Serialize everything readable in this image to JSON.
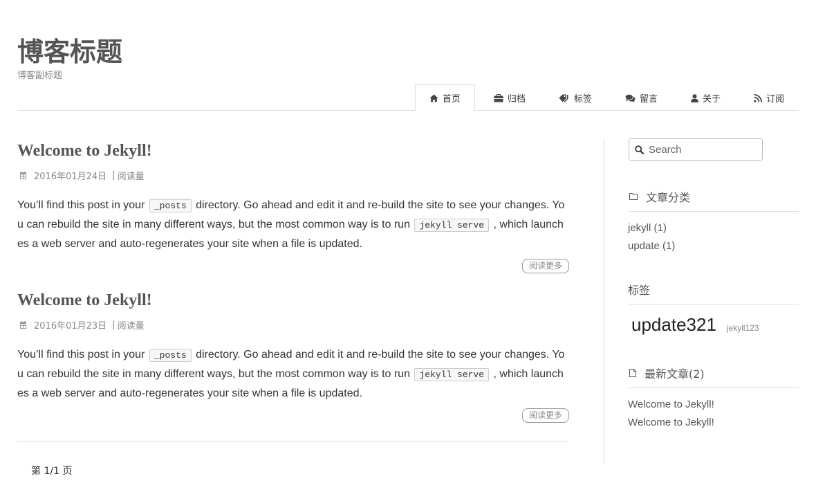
{
  "site": {
    "title": "博客标题",
    "subtitle": "博客副标题"
  },
  "nav": {
    "items": [
      {
        "label": "首页",
        "icon": "home-icon",
        "active": true
      },
      {
        "label": "归档",
        "icon": "briefcase-icon",
        "active": false
      },
      {
        "label": "标签",
        "icon": "tags-icon",
        "active": false
      },
      {
        "label": "留言",
        "icon": "comments-icon",
        "active": false
      },
      {
        "label": "关于",
        "icon": "user-icon",
        "active": false
      },
      {
        "label": "订阅",
        "icon": "rss-icon",
        "active": false
      }
    ]
  },
  "posts": [
    {
      "title": "Welcome to Jekyll!",
      "date_icon": "calendar-icon",
      "date": "2016年01月24日",
      "separator": "|",
      "views_label": "阅读量",
      "excerpt": {
        "text1": "You’ll find this post in your",
        "code1": "_posts",
        "text2": "directory. Go ahead and edit it and re-build the site to see your changes. You can rebuild the site in many different ways, but the most common way is to run",
        "code2": "jekyll serve",
        "text3": ", which launches a web server and auto-regenerates your site when a file is updated."
      },
      "read_more": "阅读更多"
    },
    {
      "title": "Welcome to Jekyll!",
      "date_icon": "calendar-icon",
      "date": "2016年01月23日",
      "separator": "|",
      "views_label": "阅读量",
      "excerpt": {
        "text1": "You’ll find this post in your",
        "code1": "_posts",
        "text2": "directory. Go ahead and edit it and re-build the site to see your changes. You can rebuild the site in many different ways, but the most common way is to run",
        "code2": "jekyll serve",
        "text3": ", which launches a web server and auto-regenerates your site when a file is updated."
      },
      "read_more": "阅读更多"
    }
  ],
  "pagination": {
    "label": "第 1/1 页"
  },
  "sidebar": {
    "search": {
      "placeholder": "Search",
      "icon": "search-icon"
    },
    "categories": {
      "title": "文章分类",
      "icon": "folder-icon",
      "items": [
        "jekyll (1)",
        "update (1)"
      ]
    },
    "tags": {
      "title": "标签",
      "items": [
        "update321",
        "jekyll123"
      ]
    },
    "recent": {
      "title": "最新文章(2)",
      "icon": "file-icon",
      "items": [
        "Welcome to Jekyll!",
        "Welcome to Jekyll!"
      ]
    }
  }
}
